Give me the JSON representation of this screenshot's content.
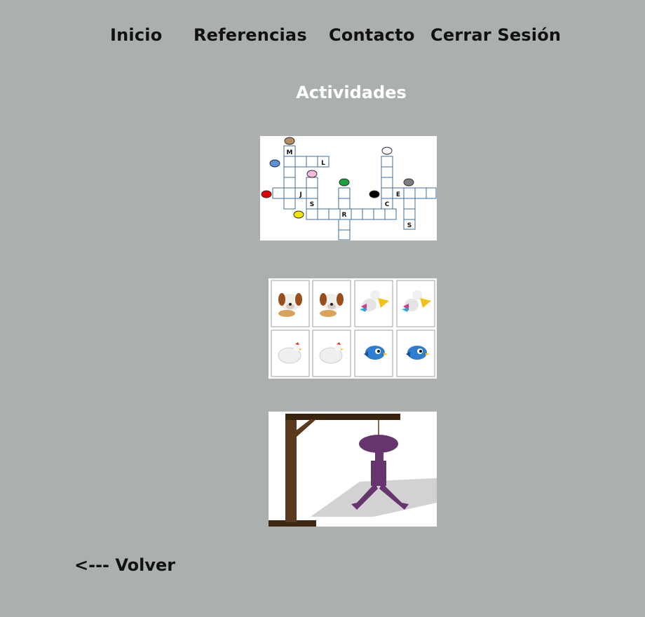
{
  "nav": {
    "home": "Inicio",
    "references": "Referencias",
    "contact": "Contacto",
    "logout": "Cerrar Sesión"
  },
  "page_title": "Actividades",
  "activities": {
    "crossword": {
      "icon": "crossword-colors-image",
      "letters": [
        "M",
        "L",
        "J",
        "S",
        "R",
        "C",
        "E",
        "S"
      ],
      "dot_colors": [
        "#b08f60",
        "#5b8fd8",
        "#f4b8d8",
        "#e30000",
        "#1aa33a",
        "#ffffff",
        "#000000",
        "#7e7e7e",
        "#f5e400"
      ]
    },
    "memory": {
      "icon": "memory-cards-animals-image",
      "cards": [
        "dog",
        "dog",
        "pelican",
        "pelican",
        "hen",
        "hen",
        "bluebird",
        "bluebird"
      ]
    },
    "hangman": {
      "icon": "hangman-gallows-image",
      "colors": {
        "wood": "#5a3a1f",
        "figure": "#66356e"
      }
    }
  },
  "back_link": "<--- Volver"
}
